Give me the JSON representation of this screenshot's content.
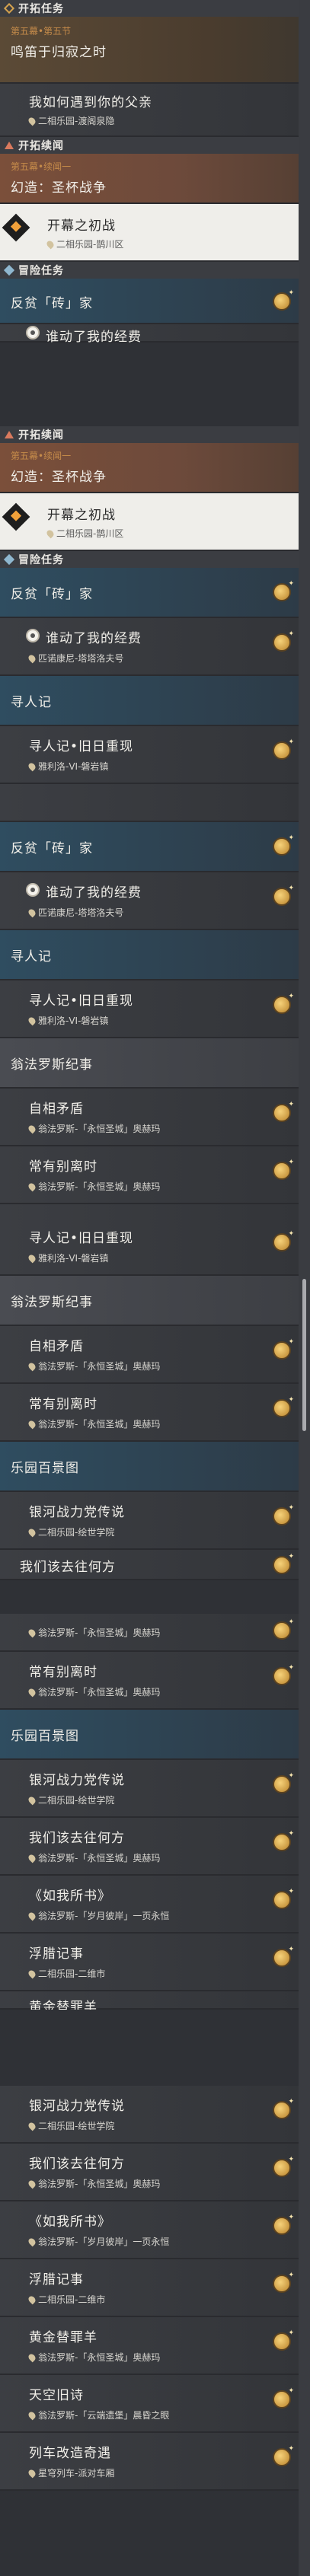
{
  "labels": {
    "trailblaze": "开拓任务",
    "companion": "开拓续闻",
    "adventure": "冒险任务"
  },
  "quests": {
    "chapter_sub": "第五幕•第五节",
    "chapter_main": "鸣笛于归寂之时",
    "father": "我如何遇到你的父亲",
    "father_loc": "二相乐园-渡阁泉隐",
    "companion_sub": "第五幕•续闻一",
    "companion_main": "幻造：圣杯战争",
    "opening": "开幕之初战",
    "opening_loc": "二相乐园-鹊川区",
    "brick": "反贫「砖」家",
    "moved_cheese": "谁动了我的经费",
    "moved_cheese_loc": "匹诺康尼-塔塔洛夫号",
    "seek": "寻人记",
    "seek_old": "寻人记•旧日重现",
    "seek_old_loc": "雅利洛-VI-磐岩镇",
    "amphoreus": "翁法罗斯纪事",
    "contradiction": "自相矛盾",
    "contradiction_loc": "翁法罗斯-「永恒圣城」奥赫玛",
    "parting": "常有别离时",
    "parting_loc": "翁法罗斯-「永恒圣城」奥赫玛",
    "park": "乐园百景图",
    "galaxy": "银河战力党传说",
    "galaxy_loc": "二相乐园-绘世学院",
    "where": "我们该去往何方",
    "where_loc": "翁法罗斯-「永恒圣城」奥赫玛",
    "as_is": "《如我所书》",
    "as_is_loc": "翁法罗斯-「岁月彼岸」一页永恒",
    "floating": "浮腊记事",
    "floating_loc": "二相乐园-二维市",
    "golden_sheep": "黄金替罪羊",
    "golden_sheep_loc": "翁法罗斯-「永恒圣城」奥赫玛",
    "sky_old": "天空旧诗",
    "sky_old_loc": "翁法罗斯-「云端遗堡」晨昏之眼",
    "train": "列车改造奇遇",
    "train_loc": "星穹列车-派对车厢"
  },
  "colors": {
    "accent": "#c6a15d",
    "subtitle": "#c58b4a",
    "selected_bg": "#efeeea"
  }
}
